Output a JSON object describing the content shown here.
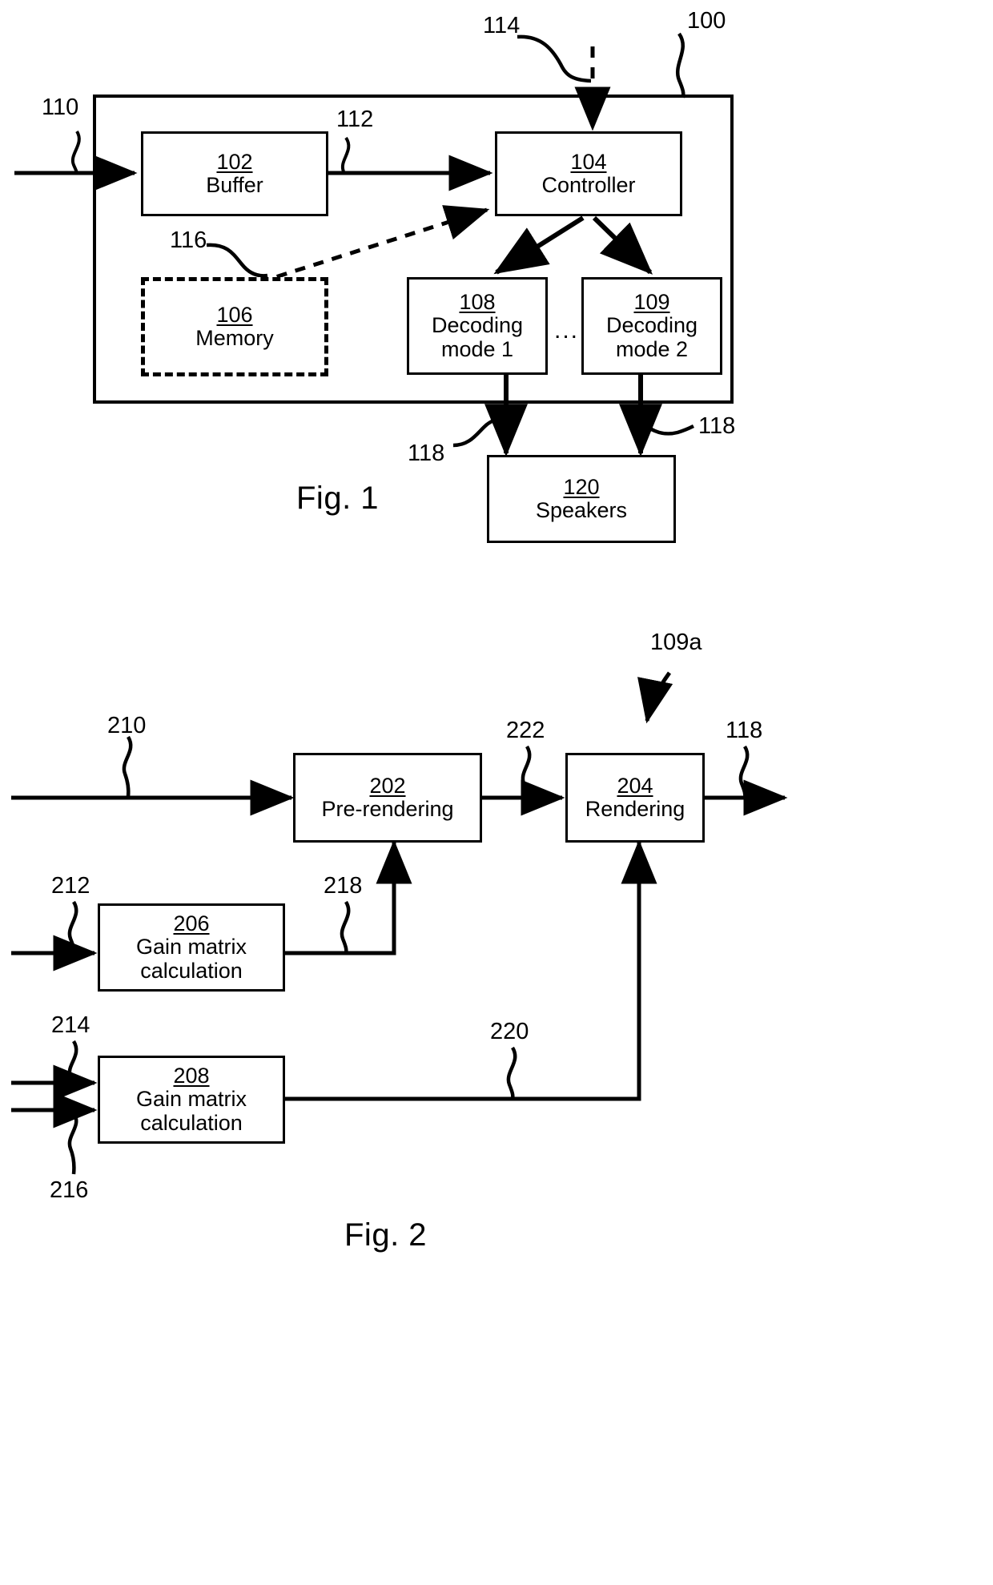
{
  "figure1": {
    "caption": "Fig. 1",
    "system_ref": "100",
    "boxes": [
      {
        "ref": "102",
        "label": "Buffer"
      },
      {
        "ref": "104",
        "label": "Controller"
      },
      {
        "ref": "106",
        "label": "Memory"
      },
      {
        "ref": "108",
        "label": "Decoding\nmode 1"
      },
      {
        "ref": "109",
        "label": "Decoding\nmode 2"
      },
      {
        "ref": "120",
        "label": "Speakers"
      }
    ],
    "box_labels": {
      "buffer": "Buffer",
      "controller": "Controller",
      "memory": "Memory",
      "decoding_mode_1_line1": "Decoding",
      "decoding_mode_1_line2": "mode 1",
      "decoding_mode_2_line1": "Decoding",
      "decoding_mode_2_line2": "mode 2",
      "speakers": "Speakers"
    },
    "box_refs": {
      "buffer": "102",
      "controller": "104",
      "memory": "106",
      "decoding_mode_1": "108",
      "decoding_mode_2": "109",
      "speakers": "120"
    },
    "signal_tags": {
      "input_stream": "110",
      "buffer_output": "112",
      "control_input": "114",
      "memory_link": "116",
      "decoder_output_left": "118",
      "decoder_output_right": "118",
      "system": "100"
    },
    "ellipsis": "..."
  },
  "figure2": {
    "caption": "Fig. 2",
    "renderer_ref": "109a",
    "box_refs": {
      "pre_rendering": "202",
      "rendering": "204",
      "gain_matrix_top": "206",
      "gain_matrix_bottom": "208"
    },
    "box_labels": {
      "pre_rendering": "Pre-rendering",
      "rendering": "Rendering",
      "gain_matrix_line1": "Gain matrix",
      "gain_matrix_line2": "calculation"
    },
    "signal_tags": {
      "audio_input": "210",
      "metadata_input_top": "212",
      "metadata_input_mid": "214",
      "metadata_input_bottom": "216",
      "gain_to_prerender": "218",
      "gain_to_render": "220",
      "prerender_output": "222",
      "render_output": "118"
    }
  },
  "colors": {
    "ink": "#000000",
    "paper": "#ffffff"
  }
}
